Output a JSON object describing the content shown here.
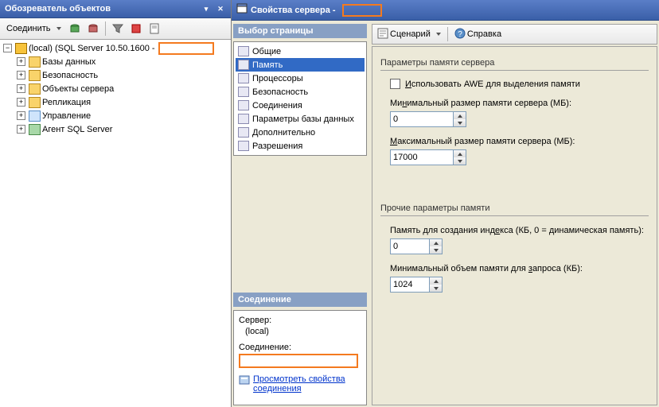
{
  "left": {
    "title": "Обозреватель объектов",
    "toolbar": {
      "connect": "Соединить",
      "icons": [
        "db-icon",
        "db-node-icon",
        "filter-icon",
        "stop-icon",
        "note-icon"
      ]
    },
    "root": "(local) (SQL Server 10.50.1600 -",
    "children": [
      {
        "icon": "folder",
        "label": "Базы данных"
      },
      {
        "icon": "folder",
        "label": "Безопасность"
      },
      {
        "icon": "folder",
        "label": "Объекты сервера"
      },
      {
        "icon": "folder",
        "label": "Репликация"
      },
      {
        "icon": "mgmt",
        "label": "Управление"
      },
      {
        "icon": "agent",
        "label": "Агент SQL Server"
      }
    ]
  },
  "dialog": {
    "title": "Свойства сервера -",
    "page_sel_header": "Выбор страницы",
    "pages": [
      "Общие",
      "Память",
      "Процессоры",
      "Безопасность",
      "Соединения",
      "Параметры базы данных",
      "Дополнительно",
      "Разрешения"
    ],
    "selected_page_index": 1,
    "conn_header": "Соединение",
    "conn": {
      "server_label": "Сервер:",
      "server_value": "(local)",
      "conn_label": "Соединение:",
      "view_link": "Просмотреть свойства соединения"
    },
    "top_toolbar": {
      "script": "Сценарий",
      "help": "Справка"
    },
    "content": {
      "group1": "Параметры памяти сервера",
      "awe": "Использовать AWE для выделения памяти",
      "min_label": "Минимальный размер памяти сервера (МБ):",
      "min_value": "0",
      "max_label": "Максимальный размер памяти сервера (МБ):",
      "max_value": "17000",
      "group2": "Прочие параметры памяти",
      "idx_label": "Память для создания индекса (КБ, 0 = динамическая память):",
      "idx_value": "0",
      "qry_label": "Минимальный объем памяти для запроса (КБ):",
      "qry_value": "1024"
    }
  }
}
